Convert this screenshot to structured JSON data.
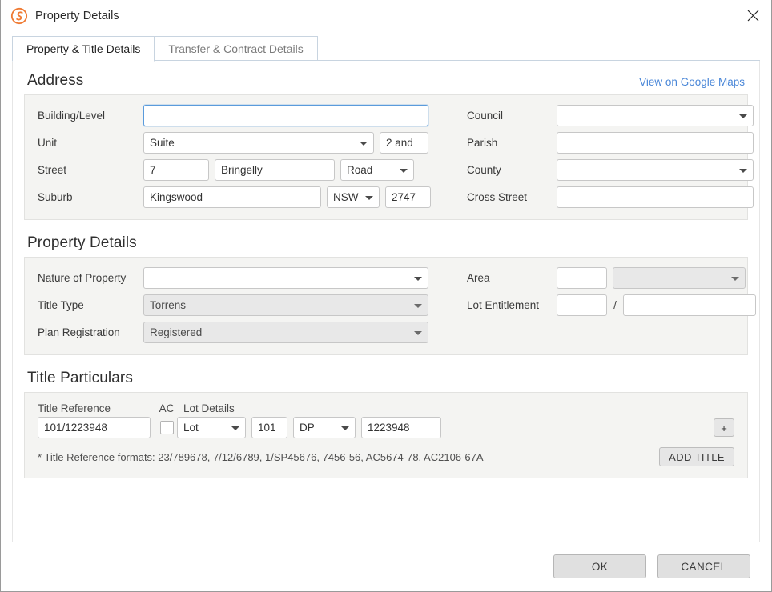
{
  "window": {
    "title": "Property Details",
    "logo_icon": "spiral-s-logo-icon",
    "close_icon": "close-icon",
    "accent_color": "#ef7a33",
    "link_color": "#4a87d8",
    "panel_color": "#f4f4f2"
  },
  "tabs": [
    {
      "label": "Property & Title Details",
      "active": true
    },
    {
      "label": "Transfer & Contract Details",
      "active": false
    }
  ],
  "address": {
    "title": "Address",
    "maps_link": "View on Google Maps",
    "building_level": {
      "label": "Building/Level",
      "value": "",
      "placeholder": ""
    },
    "unit": {
      "label": "Unit",
      "type_value": "Suite",
      "number_value": "2 and",
      "number_placeholder": ""
    },
    "street": {
      "label": "Street",
      "number_value": "7",
      "name_value": "Bringelly",
      "type_value": "Road"
    },
    "suburb": {
      "label": "Suburb",
      "name_value": "Kingswood",
      "state_value": "NSW",
      "postcode_value": "2747"
    },
    "council": {
      "label": "Council",
      "value": ""
    },
    "parish": {
      "label": "Parish",
      "value": ""
    },
    "county": {
      "label": "County",
      "value": ""
    },
    "cross_street": {
      "label": "Cross Street",
      "value": ""
    }
  },
  "property_details": {
    "title": "Property Details",
    "nature_of_property": {
      "label": "Nature of Property",
      "value": ""
    },
    "title_type": {
      "label": "Title Type",
      "value": "Torrens"
    },
    "plan_registration": {
      "label": "Plan Registration",
      "value": "Registered"
    },
    "area": {
      "label": "Area",
      "value": "",
      "unit_value": ""
    },
    "lot_entitlement": {
      "label": "Lot Entitlement",
      "numerator": "",
      "separator": "/",
      "denominator": ""
    }
  },
  "title_particulars": {
    "title": "Title Particulars",
    "headers": {
      "title_reference": "Title Reference",
      "ac": "AC",
      "lot_details": "Lot Details"
    },
    "row": {
      "title_reference_value": "101/1223948",
      "ac_checked": false,
      "lot_label_value": "Lot",
      "lot_number_value": "101",
      "plan_type_value": "DP",
      "plan_number_value": "1223948",
      "add_row_label": "+"
    },
    "note": "* Title Reference formats: 23/789678, 7/12/6789, 1/SP45676, 7456-56, AC5674-78, AC2106-67A",
    "add_title_label": "ADD TITLE"
  },
  "footer": {
    "ok_label": "OK",
    "cancel_label": "CANCEL"
  }
}
